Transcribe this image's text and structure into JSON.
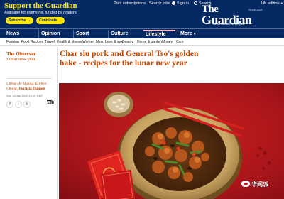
{
  "masthead": {
    "support_title": "Support the Guardian",
    "support_subtitle": "Available for everyone, funded by readers",
    "subscribe_label": "Subscribe",
    "contribute_label": "Contribute",
    "arrow": "→",
    "top_links": [
      "Print subscriptions",
      "Search jobs",
      "Sign in",
      "Search"
    ],
    "edition": "UK edition",
    "logo_the": "The",
    "logo_word": "Guardian",
    "since": "Since 1821",
    "award": "News website of the year",
    "colors": {
      "background": "#052962",
      "accent": "#ffe500"
    }
  },
  "pillars": [
    {
      "label": "News",
      "active": false
    },
    {
      "label": "Opinion",
      "active": false
    },
    {
      "label": "Sport",
      "active": false
    },
    {
      "label": "Culture",
      "active": false
    },
    {
      "label": "Lifestyle",
      "active": true
    },
    {
      "label": "More",
      "active": false
    }
  ],
  "subnav": [
    "Fashion",
    "Food",
    "Recipes",
    "Travel",
    "Health & fitness",
    "Women",
    "Men",
    "Love & sex",
    "Beauty",
    "Home & garden",
    "Money",
    "Cars"
  ],
  "article": {
    "series": "The Observer",
    "series_sub": "Lunar new year",
    "byline_authors": "Ching-He Huang, Ercben Chang,",
    "byline_photographer": "Fuchsia Dunlop",
    "date": "Sun 16 Jan 2022 10:00 GMT",
    "share_icons": [
      "facebook-icon",
      "twitter-icon",
      "email-icon"
    ],
    "comment_count": "188",
    "headline": "Char siu pork and General Tso's golden hake - recipes for the lunar new year",
    "accent_color": "#c74600"
  },
  "watermark": "华闻派"
}
